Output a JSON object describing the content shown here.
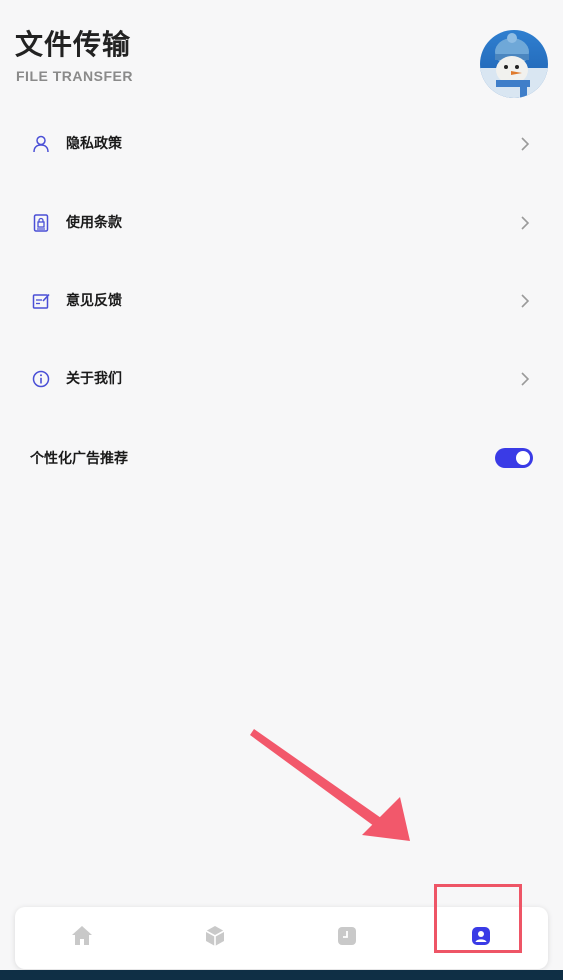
{
  "header": {
    "title": "文件传输",
    "subtitle": "FILE TRANSFER"
  },
  "avatar": {
    "icon": "user-avatar-snowman-icon"
  },
  "menu": {
    "items": [
      {
        "label": "隐私政策",
        "icon": "person-icon"
      },
      {
        "label": "使用条款",
        "icon": "document-lock-icon"
      },
      {
        "label": "意见反馈",
        "icon": "edit-note-icon"
      },
      {
        "label": "关于我们",
        "icon": "info-icon"
      }
    ]
  },
  "settings": {
    "personalized_ads_label": "个性化广告推荐",
    "personalized_ads_enabled": true
  },
  "tabbar": {
    "tabs": [
      {
        "icon": "home-icon",
        "active": false
      },
      {
        "icon": "box-icon",
        "active": false
      },
      {
        "icon": "clock-icon",
        "active": false
      },
      {
        "icon": "profile-icon",
        "active": true
      }
    ]
  },
  "colors": {
    "accent": "#3a3be6",
    "icon_accent": "#4a4fd6",
    "inactive_tab": "#c9c9c9",
    "annotation_red": "#ee5566",
    "background": "#f7f7f8"
  }
}
